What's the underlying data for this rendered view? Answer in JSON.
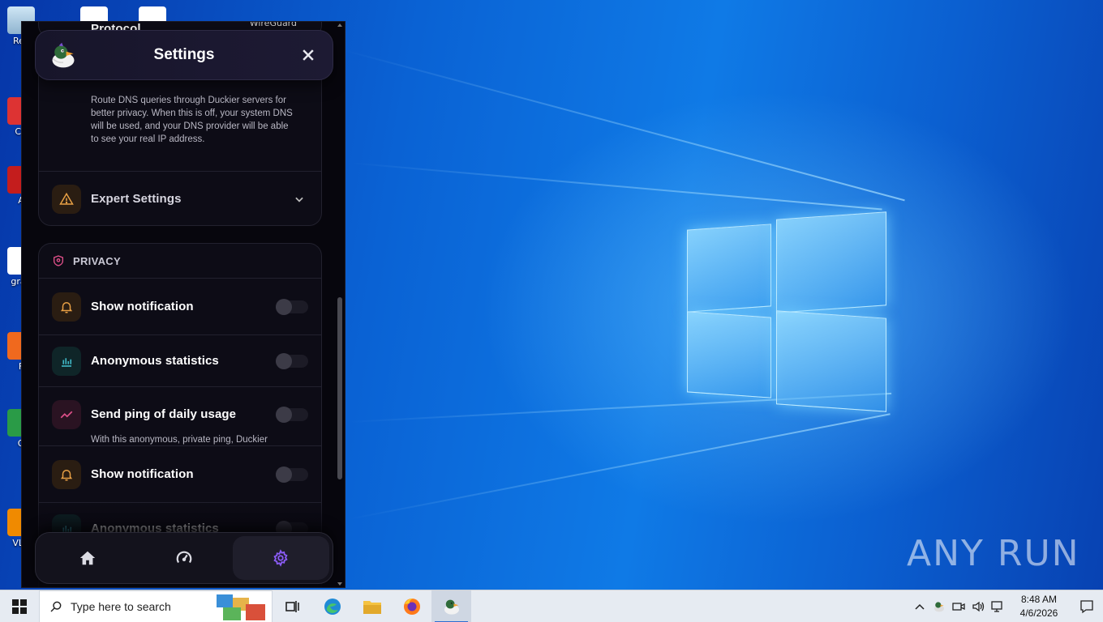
{
  "window": {
    "title": "Settings"
  },
  "top_partial": {
    "protocol_label": "Protocol",
    "protocol_value": "WireGuard"
  },
  "dns_card": {
    "description": "Route DNS queries through Duckier servers for better privacy. When this is off, your system DNS will be used, and your DNS provider will be able to see your real IP address.",
    "expert_label": "Expert Settings"
  },
  "privacy": {
    "heading": "PRIVACY",
    "items": [
      {
        "label": "Show notification",
        "icon": "bell-icon",
        "enabled": false
      },
      {
        "label": "Anonymous statistics",
        "icon": "bar-chart-icon",
        "enabled": false
      },
      {
        "label": "Send ping of daily usage",
        "icon": "trend-icon",
        "enabled": false,
        "description_partial": "With this anonymous, private ping, Duckier"
      },
      {
        "label": "Show notification",
        "icon": "bell-icon",
        "enabled": false
      },
      {
        "label": "Anonymous statistics",
        "icon": "bar-chart-icon",
        "enabled": false
      }
    ]
  },
  "bottom_nav": {
    "items": [
      {
        "name": "home",
        "icon": "home-icon",
        "active": false
      },
      {
        "name": "speed",
        "icon": "speedometer-icon",
        "active": false
      },
      {
        "name": "settings",
        "icon": "gear-icon",
        "active": true
      }
    ]
  },
  "taskbar": {
    "search_placeholder": "Type here to search",
    "time": "8:48 AM",
    "date": "4/6/2026"
  },
  "watermark": "ANY RUN",
  "colors": {
    "accent": "#8b5cf6",
    "orange": "#e8a045",
    "teal": "#3fb6c4",
    "pink": "#e0508a"
  }
}
